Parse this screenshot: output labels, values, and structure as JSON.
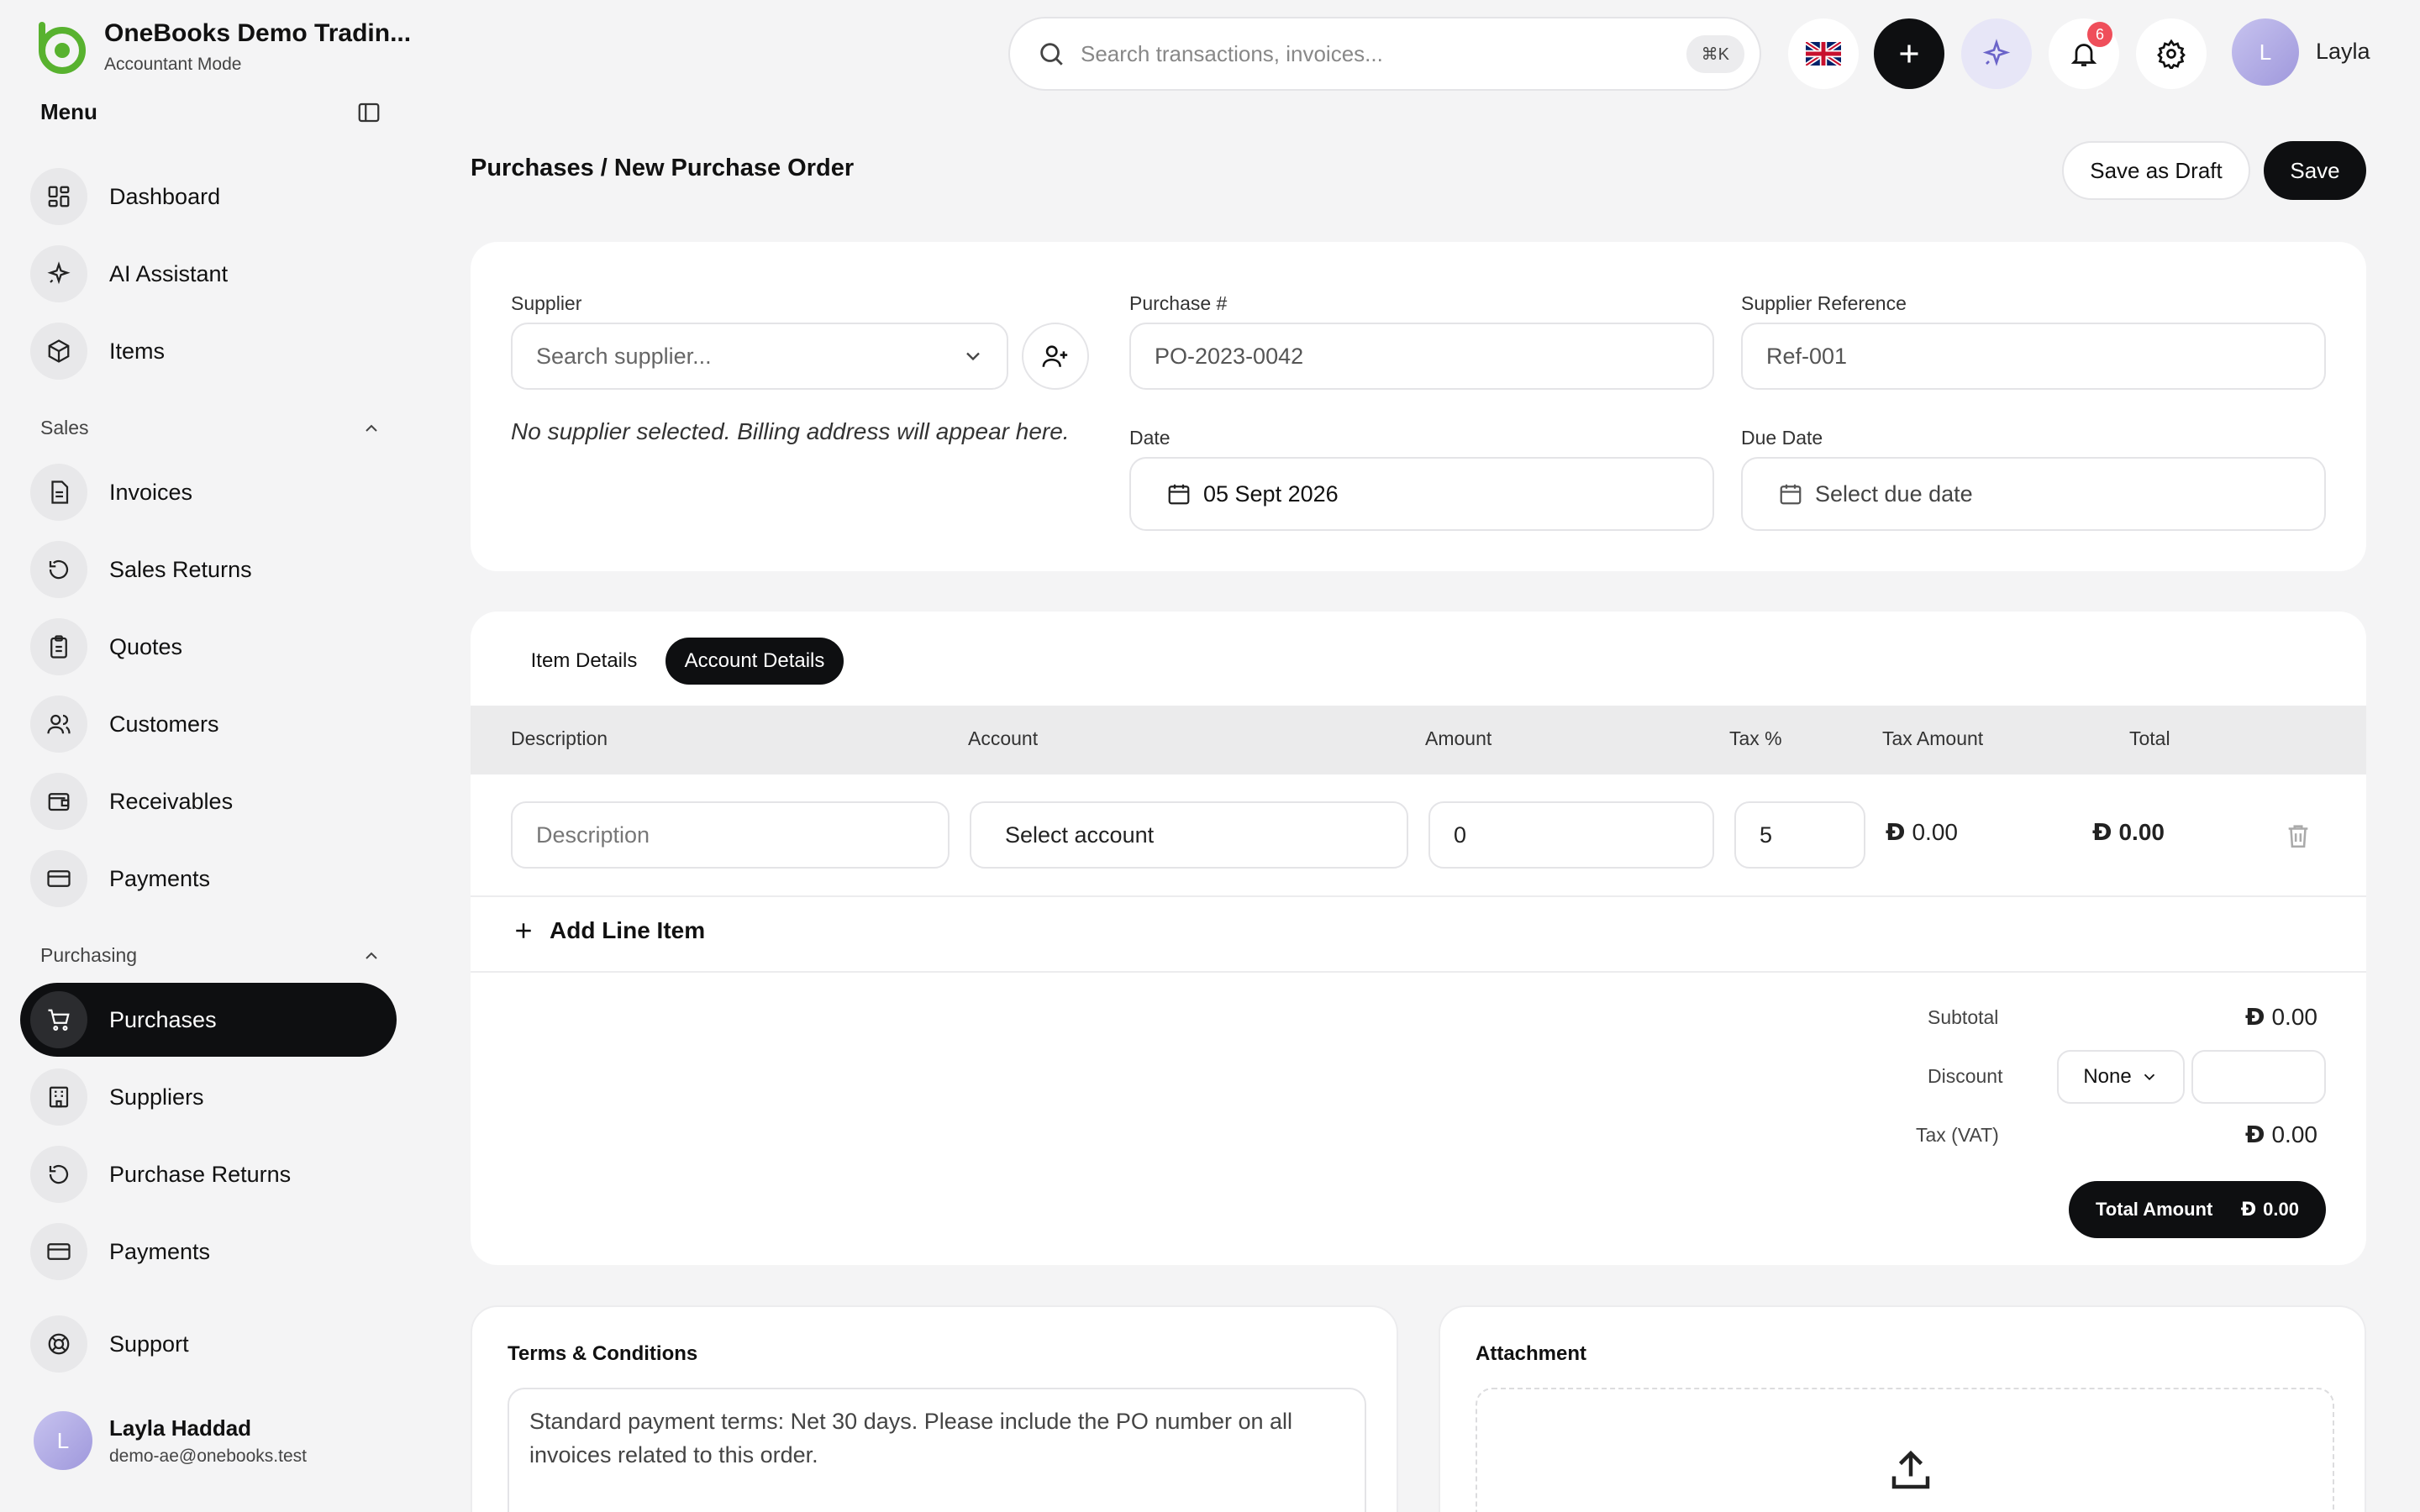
{
  "brand": {
    "name": "OneBooks Demo Tradin...",
    "mode": "Accountant Mode"
  },
  "menu": {
    "title": "Menu"
  },
  "nav": {
    "top": [
      {
        "label": "Dashboard",
        "icon": "dashboard-icon"
      },
      {
        "label": "AI Assistant",
        "icon": "sparkle-icon"
      },
      {
        "label": "Items",
        "icon": "box-icon"
      }
    ],
    "sales_label": "Sales",
    "sales": [
      {
        "label": "Invoices",
        "icon": "document-icon"
      },
      {
        "label": "Sales Returns",
        "icon": "return-icon"
      },
      {
        "label": "Quotes",
        "icon": "clipboard-icon"
      },
      {
        "label": "Customers",
        "icon": "users-icon"
      },
      {
        "label": "Receivables",
        "icon": "wallet-icon"
      },
      {
        "label": "Payments",
        "icon": "card-icon"
      }
    ],
    "purchasing_label": "Purchasing",
    "purchasing": [
      {
        "label": "Purchases",
        "icon": "cart-icon",
        "active": true
      },
      {
        "label": "Suppliers",
        "icon": "building-icon"
      },
      {
        "label": "Purchase Returns",
        "icon": "return-icon"
      },
      {
        "label": "Payments",
        "icon": "card-icon"
      }
    ],
    "support": {
      "label": "Support",
      "icon": "lifebuoy-icon"
    }
  },
  "user": {
    "initial": "L",
    "name": "Layla Haddad",
    "email": "demo-ae@onebooks.test",
    "short": "Layla"
  },
  "topbar": {
    "search_placeholder": "Search transactions, invoices...",
    "shortcut": "⌘K",
    "notifications": "6"
  },
  "page": {
    "breadcrumb": "Purchases / New Purchase Order",
    "save_draft": "Save as Draft",
    "save": "Save"
  },
  "form": {
    "supplier_label": "Supplier",
    "supplier_placeholder": "Search supplier...",
    "supplier_note": "No supplier selected. Billing address will appear here.",
    "purchase_no_label": "Purchase #",
    "purchase_no": "PO-2023-0042",
    "supplier_ref_label": "Supplier Reference",
    "supplier_ref": "Ref-001",
    "date_label": "Date",
    "date": "05 Sept 2026",
    "due_label": "Due Date",
    "due_placeholder": "Select due date"
  },
  "tabs": {
    "item": "Item Details",
    "account": "Account Details"
  },
  "table": {
    "headers": [
      "Description",
      "Account",
      "Amount",
      "Tax %",
      "Tax Amount",
      "Total"
    ],
    "row": {
      "description_placeholder": "Description",
      "account": "Select account",
      "amount": "0",
      "tax": "5",
      "tax_amount": "0.00",
      "total": "0.00"
    },
    "add_line": "Add Line Item"
  },
  "currency_symbol": "Đ",
  "summary": {
    "subtotal_label": "Subtotal",
    "subtotal": "0.00",
    "discount_label": "Discount",
    "discount_type": "None",
    "tax_label": "Tax (VAT)",
    "tax": "0.00",
    "total_label": "Total Amount",
    "total": "0.00"
  },
  "terms": {
    "title": "Terms & Conditions",
    "text": "Standard payment terms: Net 30 days. Please include the PO number on all invoices related to this order."
  },
  "attachment": {
    "title": "Attachment"
  }
}
